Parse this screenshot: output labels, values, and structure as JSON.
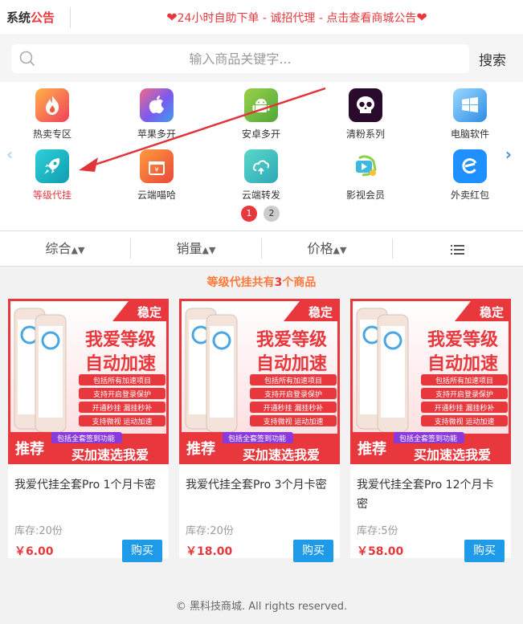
{
  "notice": {
    "title_a": "系统",
    "title_b": "公告",
    "text": "24小时自助下单 - 诚招代理 - 点击查看商城公告"
  },
  "search": {
    "placeholder": "输入商品关键字...",
    "button": "搜索"
  },
  "categories": [
    {
      "label": "热卖专区",
      "icon": "fire-icon",
      "color": "#f05a3c"
    },
    {
      "label": "苹果多开",
      "icon": "apple-icon",
      "color": "#8a6cf0"
    },
    {
      "label": "安卓多开",
      "icon": "android-icon",
      "color": "#78c043"
    },
    {
      "label": "清粉系列",
      "icon": "skull-icon",
      "color": "#3a0f3a"
    },
    {
      "label": "电脑软件",
      "icon": "windows-icon",
      "color": "#4aa6f0"
    },
    {
      "label": "等级代挂",
      "icon": "rocket-icon",
      "color": "#22b8c8"
    },
    {
      "label": "云端喵哈",
      "icon": "gift-icon",
      "color": "#f26a2e"
    },
    {
      "label": "云端转发",
      "icon": "share-icon",
      "color": "#3cc0c0"
    },
    {
      "label": "影视会员",
      "icon": "film-icon",
      "color": "#5ac25a"
    },
    {
      "label": "外卖红包",
      "icon": "ele-icon",
      "color": "#1e90ff"
    }
  ],
  "pager": [
    "1",
    "2"
  ],
  "sort": [
    "综合",
    "销量",
    "价格"
  ],
  "result": {
    "category": "等级代挂",
    "prefix": "共有",
    "count": "3",
    "suffix": "个商品"
  },
  "banner": {
    "badge": "稳定",
    "title1": "我爱等级",
    "title2": "自动加速",
    "features": [
      "包括所有加速项目",
      "支持开启登录保护",
      "开通秒挂 漏挂秒补",
      "支持微视 运动加速"
    ],
    "tag": "推荐",
    "sub": "包括全套签到功能",
    "slogan": "买加速选我爱"
  },
  "products": [
    {
      "title": "我爱代挂全套Pro 1个月卡密",
      "stock": "库存:20份",
      "price": "￥6.00",
      "buy": "购买"
    },
    {
      "title": "我爱代挂全套Pro 3个月卡密",
      "stock": "库存:20份",
      "price": "￥18.00",
      "buy": "购买"
    },
    {
      "title": "我爱代挂全套Pro 12个月卡密",
      "stock": "库存:5份",
      "price": "￥58.00",
      "buy": "购买"
    }
  ],
  "footer": "© 黑科技商城. All rights reserved.",
  "colors": {
    "accent": "#e8383d",
    "buy": "#1e9be8",
    "result": "#ff7a3c"
  }
}
